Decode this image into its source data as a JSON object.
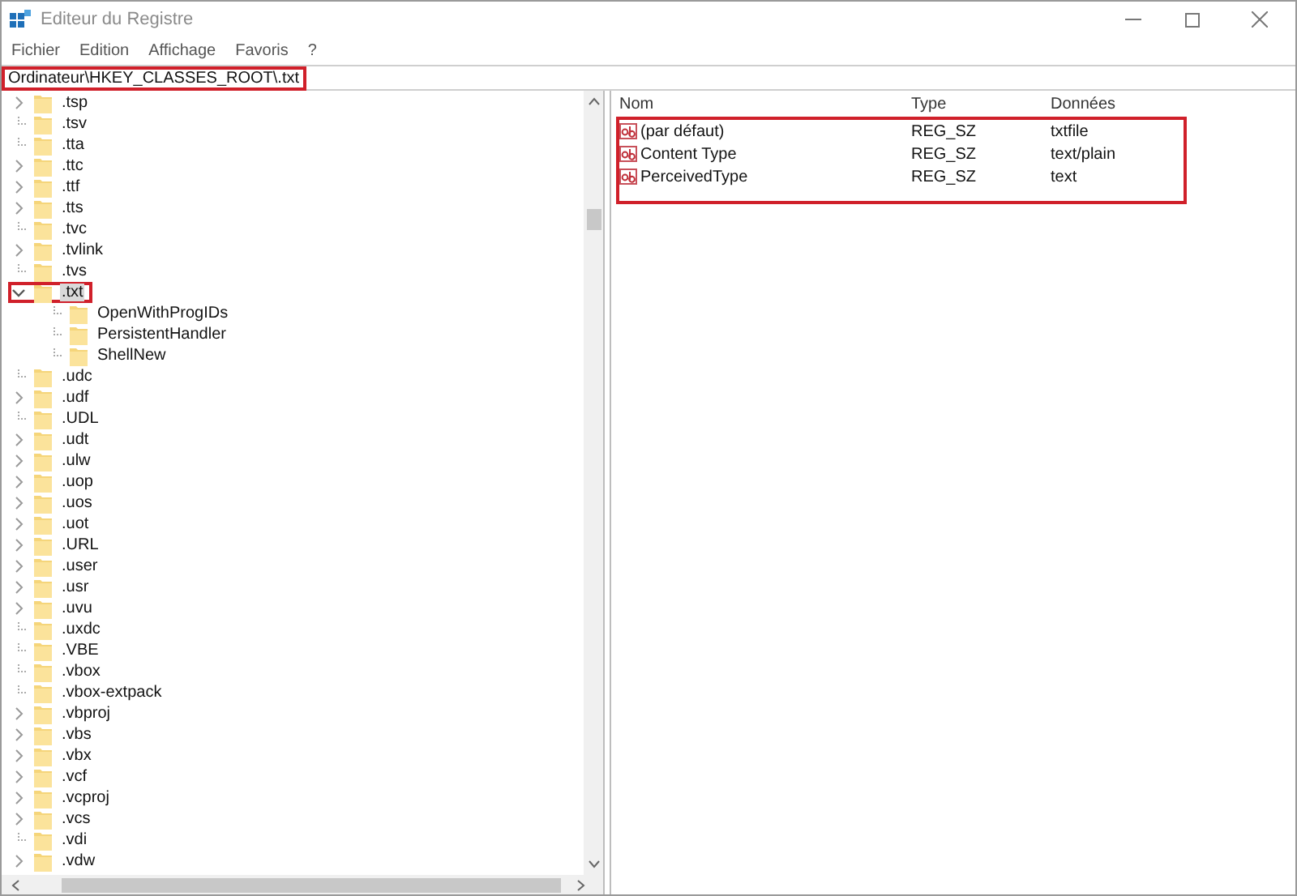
{
  "window": {
    "title": "Editeur du Registre"
  },
  "menu": [
    "Fichier",
    "Edition",
    "Affichage",
    "Favoris",
    "?"
  ],
  "address": {
    "value": "Ordinateur\\HKEY_CLASSES_ROOT\\.txt",
    "highlighted": true
  },
  "tree": [
    {
      "label": ".tsp",
      "expandable": true,
      "expanded": false,
      "selected": false,
      "highlighted": false
    },
    {
      "label": ".tsv",
      "expandable": false,
      "selected": false,
      "highlighted": false
    },
    {
      "label": ".tta",
      "expandable": false,
      "selected": false,
      "highlighted": false
    },
    {
      "label": ".ttc",
      "expandable": true,
      "expanded": false,
      "selected": false,
      "highlighted": false
    },
    {
      "label": ".ttf",
      "expandable": true,
      "expanded": false,
      "selected": false,
      "highlighted": false
    },
    {
      "label": ".tts",
      "expandable": true,
      "expanded": false,
      "selected": false,
      "highlighted": false
    },
    {
      "label": ".tvc",
      "expandable": false,
      "selected": false,
      "highlighted": false
    },
    {
      "label": ".tvlink",
      "expandable": true,
      "expanded": false,
      "selected": false,
      "highlighted": false
    },
    {
      "label": ".tvs",
      "expandable": false,
      "selected": false,
      "highlighted": false
    },
    {
      "label": ".txt",
      "expandable": true,
      "expanded": true,
      "selected": true,
      "highlighted": true,
      "children": [
        {
          "label": "OpenWithProgIDs",
          "expandable": false,
          "selected": false,
          "highlighted": false
        },
        {
          "label": "PersistentHandler",
          "expandable": false,
          "selected": false,
          "highlighted": false
        },
        {
          "label": "ShellNew",
          "expandable": false,
          "selected": false,
          "highlighted": false
        }
      ]
    },
    {
      "label": ".udc",
      "expandable": false,
      "selected": false,
      "highlighted": false
    },
    {
      "label": ".udf",
      "expandable": true,
      "expanded": false,
      "selected": false,
      "highlighted": false
    },
    {
      "label": ".UDL",
      "expandable": false,
      "selected": false,
      "highlighted": false
    },
    {
      "label": ".udt",
      "expandable": true,
      "expanded": false,
      "selected": false,
      "highlighted": false
    },
    {
      "label": ".ulw",
      "expandable": true,
      "expanded": false,
      "selected": false,
      "highlighted": false
    },
    {
      "label": ".uop",
      "expandable": true,
      "expanded": false,
      "selected": false,
      "highlighted": false
    },
    {
      "label": ".uos",
      "expandable": true,
      "expanded": false,
      "selected": false,
      "highlighted": false
    },
    {
      "label": ".uot",
      "expandable": true,
      "expanded": false,
      "selected": false,
      "highlighted": false
    },
    {
      "label": ".URL",
      "expandable": true,
      "expanded": false,
      "selected": false,
      "highlighted": false
    },
    {
      "label": ".user",
      "expandable": true,
      "expanded": false,
      "selected": false,
      "highlighted": false
    },
    {
      "label": ".usr",
      "expandable": true,
      "expanded": false,
      "selected": false,
      "highlighted": false
    },
    {
      "label": ".uvu",
      "expandable": true,
      "expanded": false,
      "selected": false,
      "highlighted": false
    },
    {
      "label": ".uxdc",
      "expandable": false,
      "selected": false,
      "highlighted": false
    },
    {
      "label": ".VBE",
      "expandable": false,
      "selected": false,
      "highlighted": false
    },
    {
      "label": ".vbox",
      "expandable": false,
      "selected": false,
      "highlighted": false
    },
    {
      "label": ".vbox-extpack",
      "expandable": false,
      "selected": false,
      "highlighted": false
    },
    {
      "label": ".vbproj",
      "expandable": true,
      "expanded": false,
      "selected": false,
      "highlighted": false
    },
    {
      "label": ".vbs",
      "expandable": true,
      "expanded": false,
      "selected": false,
      "highlighted": false
    },
    {
      "label": ".vbx",
      "expandable": true,
      "expanded": false,
      "selected": false,
      "highlighted": false
    },
    {
      "label": ".vcf",
      "expandable": true,
      "expanded": false,
      "selected": false,
      "highlighted": false
    },
    {
      "label": ".vcproj",
      "expandable": true,
      "expanded": false,
      "selected": false,
      "highlighted": false
    },
    {
      "label": ".vcs",
      "expandable": true,
      "expanded": false,
      "selected": false,
      "highlighted": false
    },
    {
      "label": ".vdi",
      "expandable": false,
      "selected": false,
      "highlighted": false
    },
    {
      "label": ".vdw",
      "expandable": true,
      "expanded": false,
      "selected": false,
      "highlighted": false
    }
  ],
  "values": {
    "columns": [
      "Nom",
      "Type",
      "Données"
    ],
    "highlighted": true,
    "rows": [
      {
        "name": "(par défaut)",
        "type": "REG_SZ",
        "data": "txtfile"
      },
      {
        "name": "Content Type",
        "type": "REG_SZ",
        "data": "text/plain"
      },
      {
        "name": "PerceivedType",
        "type": "REG_SZ",
        "data": "text"
      }
    ]
  }
}
